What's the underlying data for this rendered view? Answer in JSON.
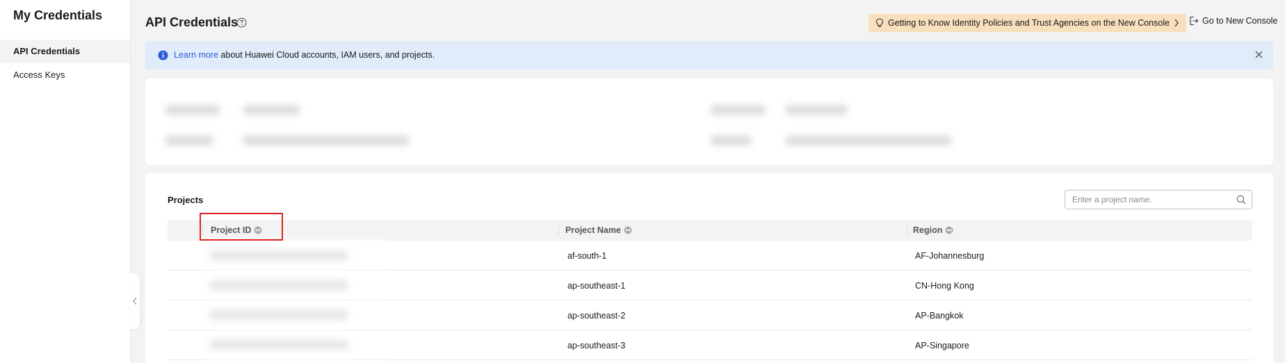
{
  "sidebar": {
    "title": "My Credentials",
    "items": [
      {
        "label": "API Credentials",
        "active": true
      },
      {
        "label": "Access Keys",
        "active": false
      }
    ]
  },
  "header": {
    "title": "API Credentials",
    "guide_link": "Getting to Know Identity Policies and Trust Agencies on the New Console",
    "new_console": "Go to New Console"
  },
  "alert": {
    "link": "Learn more",
    "text": " about Huawei Cloud accounts, IAM users, and projects."
  },
  "projects": {
    "title": "Projects",
    "search_placeholder": "Enter a project name.",
    "columns": [
      "Project ID",
      "Project Name",
      "Region"
    ],
    "rows": [
      {
        "project_name": "af-south-1",
        "region": "AF-Johannesburg"
      },
      {
        "project_name": "ap-southeast-1",
        "region": "CN-Hong Kong"
      },
      {
        "project_name": "ap-southeast-2",
        "region": "AP-Bangkok"
      },
      {
        "project_name": "ap-southeast-3",
        "region": "AP-Singapore"
      }
    ]
  },
  "colors": {
    "accent": "#2b5fd9",
    "banner_bg": "#f8dfbd",
    "alert_bg": "#e1ecfb",
    "highlight": "#e02020"
  }
}
